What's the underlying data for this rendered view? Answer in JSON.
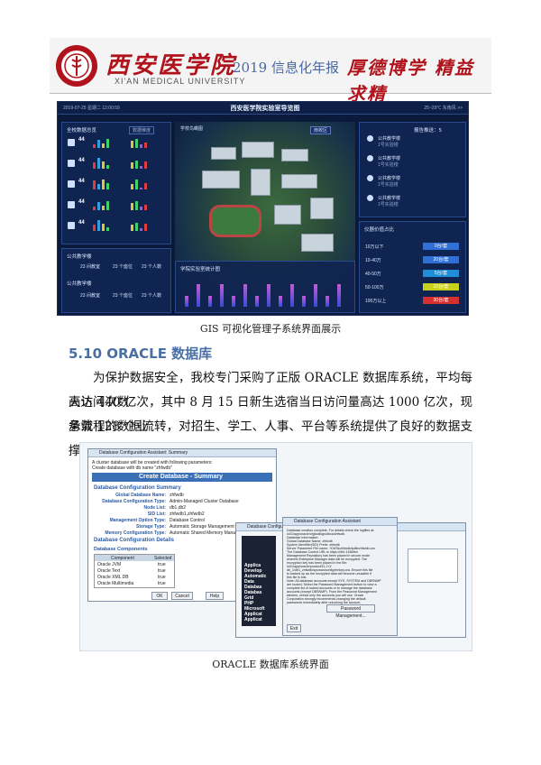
{
  "header": {
    "school_cn": "西安医学院",
    "school_en": "XI'AN MEDICAL UNIVERSITY",
    "report_title": "2019 信息化年报",
    "motto": "厚德博学 精益求精"
  },
  "gis": {
    "timestamp": "2019-07-25 星期二 12:00:59",
    "title": "西安医学院实验室导览图",
    "weather": "25~29℃ 东南风 >>",
    "left_panel_title": "全校数据总览",
    "left_filter": "数据维度",
    "left_counts": [
      "44",
      "44",
      "44",
      "44",
      "44"
    ],
    "public_label_1": "公共教学楼",
    "public_label_2": "公共教学楼",
    "public_items": [
      "23 间教室",
      "23 个座位",
      "23 个人数"
    ],
    "map_label": "学校鸟瞰图",
    "dropdown": "南校区",
    "chart_title": "学院实验室统计图",
    "right_panel_title": "报告推送：5",
    "right_items": [
      "公共教学楼",
      "公共教学楼",
      "公共教学楼",
      "公共教学楼"
    ],
    "right_sub": "1号实验楼",
    "bottom_panel_title": "仪器价值占比",
    "value_rows": [
      {
        "label": "10万以下",
        "value": "0台/套",
        "color": "#2f6fd6"
      },
      {
        "label": "10-40万",
        "value": "20台/套",
        "color": "#2f6fd6"
      },
      {
        "label": "40-50万",
        "value": "5台/套",
        "color": "#1f8ed6"
      },
      {
        "label": "50-100万",
        "value": "10台/套",
        "color": "#c9d21a"
      },
      {
        "label": "100万以上",
        "value": "30台/套",
        "color": "#d62f2f"
      }
    ]
  },
  "gis_caption": "GIS 可视化管理子系统界面展示",
  "section": {
    "title": "5.10 ORACLE 数据库",
    "paragraph_lines": [
      "为保护数据安全，我校专门采购了正版 ORACLE 数据库系统，平均每天访问次数",
      "高达 440 亿次，其中 8 月 15 日新生选宿当日访问量高达 1000 亿次，现承载 128 个业",
      "务流程的数据流转，对招生、学工、人事、平台等系统提供了良好的数据支撑。"
    ]
  },
  "oracle": {
    "win1_title": "Database Configuration Assistant: Summary",
    "win1_intro_1": "A cluster database will be created with following parameters:",
    "win1_intro_2": "Create database with db name \"zhfwdb\"",
    "win1_heading": "Create Database - Summary",
    "config_summary": "Database Configuration Summary",
    "fields": [
      {
        "k": "Global Database Name:",
        "v": "zhfwdb"
      },
      {
        "k": "Database Configuration Type:",
        "v": "Admin-Managed Cluster Database"
      },
      {
        "k": "Node List:",
        "v": "db1,db2"
      },
      {
        "k": "SID List:",
        "v": "zhfwdb1,zhfwdb2"
      },
      {
        "k": "Management Option Type:",
        "v": "Database Control"
      },
      {
        "k": "Storage Type:",
        "v": "Automatic Storage Management (ASM)"
      },
      {
        "k": "Memory Configuration Type:",
        "v": "Automatic Shared Memory Management"
      }
    ],
    "config_details": "Database Configuration Details",
    "components_heading": "Database Components",
    "components_head": [
      "Component",
      "Selected"
    ],
    "components": [
      {
        "c": "Oracle JVM",
        "s": "true"
      },
      {
        "c": "Oracle Text",
        "s": "true"
      },
      {
        "c": "Oracle XML DB",
        "s": "true"
      },
      {
        "c": "Oracle Multimedia",
        "s": "true"
      }
    ],
    "btn_ok": "OK",
    "btn_cancel": "Cancel",
    "btn_help": "Help",
    "win2_title": "Database Configuration Assistant",
    "win3_title": "Database Configuration Assistant",
    "win3_lines": [
      "Database creation complete. For details check the logfiles at:",
      " /u01/app/oracle/cfgtoollogs/dbca/zhfwdb.",
      "Database Information:",
      " Global Database Name:        zhfwdb",
      " System Identifier(SID) Prefix: zhfwdb",
      " Server Parameter File name:  +DATA/zhfwdb/spfilezhfwdb.ora",
      "The Database Control URL is https://db1:1158/em",
      "Management Repository has been placed in secure mode",
      "wherein Enterprise Manager data will be encrypted. The",
      "encryption key has been placed in the file:",
      " /u01/app/oracle/product/11.2.0/",
      " db_1/db1_zhfwdb/sysman/config/emkey.ora. Ensure this file",
      " is backed up as the encrypted data will become unusable if",
      " this file is lost.",
      "Note: All database accounts except SYS, SYSTEM and DBSNMP",
      "are locked. Select the Password Management button to view a",
      "complete list of locked accounts or to manage the database",
      "accounts (except DBSNMP). From the Password Management",
      "window, unlock only the accounts you will use. Oracle",
      "Corporation strongly recommends changing the default",
      "passwords immediately after unlocking the account."
    ],
    "btn_password": "Password Management...",
    "btn_exit": "Exit",
    "side_text": [
      "Applica",
      "Develop",
      "Automatic",
      "Data",
      "Databas",
      "Databas",
      "Grid",
      "PHP",
      "Microsoft",
      "Applicat",
      "Applicat"
    ]
  },
  "oracle_caption": "ORACLE 数据库系统界面"
}
